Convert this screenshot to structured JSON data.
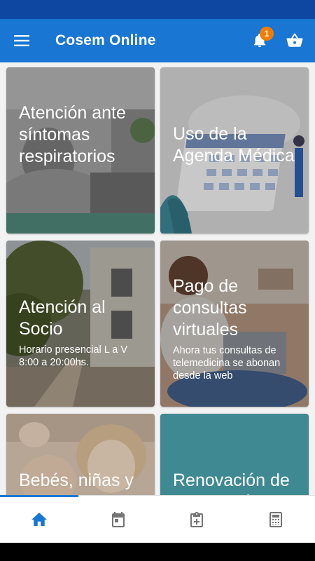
{
  "app": {
    "title": "Cosem Online",
    "accent": "#1976d2",
    "status_bar_color": "#0d47a1"
  },
  "header": {
    "menu_icon": "hamburger-menu-icon",
    "notifications_icon": "bell-icon",
    "notifications_count": "1",
    "cart_icon": "basket-icon"
  },
  "cards": [
    {
      "title": "Atención ante síntomas respiratorios",
      "subtitle": ""
    },
    {
      "title": "Uso de la Agenda Médica",
      "subtitle": ""
    },
    {
      "title": "Atención al Socio",
      "subtitle": "Horario presencial L a V 8:00 a 20:00hs."
    },
    {
      "title": "Pago de consultas virtuales",
      "subtitle": "Ahora tus consultas de telemedicina se abonan desde la web"
    },
    {
      "title": "Bebés, niñas y niños",
      "subtitle": ""
    },
    {
      "title": "Renovación de Medicación",
      "subtitle": ""
    }
  ],
  "bottom_nav": {
    "items": [
      "home-icon",
      "calendar-icon",
      "clipboard-plus-icon",
      "calculator-icon"
    ],
    "active": "home-icon",
    "active_color": "#1976d2",
    "inactive_color": "#757575"
  }
}
